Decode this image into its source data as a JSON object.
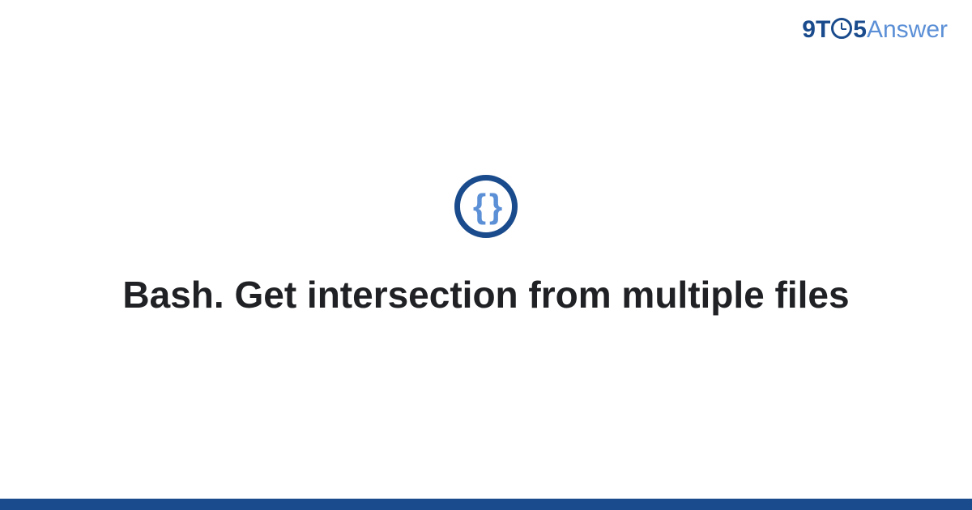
{
  "logo": {
    "nine": "9",
    "t": "T",
    "five": "5",
    "answer": "Answer"
  },
  "icon": {
    "braces": "{ }"
  },
  "title": "Bash. Get intersection from multiple files"
}
